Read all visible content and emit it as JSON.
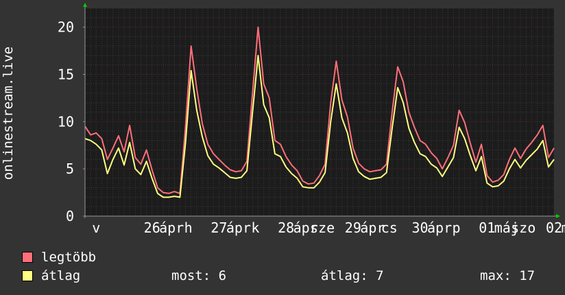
{
  "chart_data": {
    "type": "line",
    "ylabel": "onlinestream.live",
    "ylim": [
      0,
      22
    ],
    "yticks": [
      0,
      5,
      10,
      15,
      20
    ],
    "grid": true,
    "xlim": [
      0,
      168
    ],
    "xtick_labels": [
      {
        "x": 4,
        "label": "v"
      },
      {
        "x": 24,
        "label": "26"
      },
      {
        "x": 31,
        "label": "ápr"
      },
      {
        "x": 37,
        "label": "h"
      },
      {
        "x": 48,
        "label": "27"
      },
      {
        "x": 55,
        "label": "ápr"
      },
      {
        "x": 61,
        "label": "k"
      },
      {
        "x": 72,
        "label": "28"
      },
      {
        "x": 79,
        "label": "ápr"
      },
      {
        "x": 85,
        "label": "sze"
      },
      {
        "x": 96,
        "label": "29"
      },
      {
        "x": 103,
        "label": "ápr"
      },
      {
        "x": 109,
        "label": "cs"
      },
      {
        "x": 120,
        "label": "30"
      },
      {
        "x": 127,
        "label": "ápr"
      },
      {
        "x": 133,
        "label": "p"
      },
      {
        "x": 144,
        "label": "01"
      },
      {
        "x": 151,
        "label": "máj"
      },
      {
        "x": 157,
        "label": "szo"
      },
      {
        "x": 168,
        "label": "02"
      },
      {
        "x": 175,
        "label": "máj"
      }
    ],
    "series": [
      {
        "name": "legtöbb",
        "color": "#ff6f7a",
        "x": [
          0,
          2,
          4,
          6,
          8,
          10,
          12,
          14,
          16,
          18,
          20,
          22,
          24,
          26,
          28,
          30,
          32,
          34,
          36,
          38,
          40,
          42,
          44,
          46,
          48,
          50,
          52,
          54,
          56,
          58,
          60,
          62,
          64,
          66,
          68,
          70,
          72,
          74,
          76,
          78,
          80,
          82,
          84,
          86,
          88,
          90,
          92,
          94,
          96,
          98,
          100,
          102,
          104,
          106,
          108,
          110,
          112,
          114,
          116,
          118,
          120,
          122,
          124,
          126,
          128,
          130,
          132,
          134,
          136,
          138,
          140,
          142,
          144,
          146,
          148,
          150,
          152,
          154,
          156,
          158,
          160,
          162,
          164,
          166,
          168
        ],
        "values": [
          9.5,
          8.6,
          8.8,
          8.2,
          6.0,
          7.2,
          8.5,
          6.8,
          9.6,
          6.2,
          5.5,
          7.0,
          4.9,
          3.0,
          2.5,
          2.4,
          2.6,
          2.4,
          9.5,
          18.0,
          13.5,
          9.8,
          7.6,
          6.6,
          6.0,
          5.4,
          4.9,
          4.7,
          4.8,
          5.8,
          13.0,
          20.0,
          14.0,
          12.5,
          8.0,
          7.6,
          6.3,
          5.4,
          4.8,
          3.7,
          3.4,
          3.5,
          4.3,
          5.5,
          12.0,
          16.4,
          12.3,
          10.5,
          7.2,
          5.6,
          5.0,
          4.7,
          4.8,
          4.9,
          5.5,
          11.0,
          15.8,
          14.2,
          11.0,
          9.4,
          8.0,
          7.6,
          6.7,
          6.1,
          5.0,
          6.2,
          7.5,
          11.2,
          9.9,
          7.7,
          5.7,
          7.6,
          4.3,
          3.6,
          3.8,
          4.4,
          6.0,
          7.2,
          6.1,
          7.1,
          7.8,
          8.6,
          9.6,
          6.2,
          7.2
        ]
      },
      {
        "name": "átlag",
        "color": "#ffff80",
        "x": [
          0,
          2,
          4,
          6,
          8,
          10,
          12,
          14,
          16,
          18,
          20,
          22,
          24,
          26,
          28,
          30,
          32,
          34,
          36,
          38,
          40,
          42,
          44,
          46,
          48,
          50,
          52,
          54,
          56,
          58,
          60,
          62,
          64,
          66,
          68,
          70,
          72,
          74,
          76,
          78,
          80,
          82,
          84,
          86,
          88,
          90,
          92,
          94,
          96,
          98,
          100,
          102,
          104,
          106,
          108,
          110,
          112,
          114,
          116,
          118,
          120,
          122,
          124,
          126,
          128,
          130,
          132,
          134,
          136,
          138,
          140,
          142,
          144,
          146,
          148,
          150,
          152,
          154,
          156,
          158,
          160,
          162,
          164,
          166,
          168
        ],
        "values": [
          8.2,
          8.0,
          7.6,
          7.0,
          4.5,
          6.0,
          7.2,
          5.4,
          7.8,
          5.0,
          4.4,
          5.8,
          4.0,
          2.4,
          2.0,
          2.0,
          2.1,
          2.0,
          7.8,
          15.4,
          11.2,
          8.4,
          6.4,
          5.5,
          5.1,
          4.6,
          4.1,
          4.0,
          4.1,
          4.8,
          11.0,
          17.0,
          11.8,
          10.4,
          6.6,
          6.3,
          5.2,
          4.5,
          4.0,
          3.1,
          3.0,
          3.0,
          3.6,
          4.6,
          10.0,
          14.0,
          10.4,
          8.8,
          6.1,
          4.7,
          4.2,
          3.9,
          4.0,
          4.1,
          4.6,
          9.3,
          13.6,
          12.0,
          9.3,
          7.8,
          6.6,
          6.3,
          5.5,
          5.1,
          4.2,
          5.2,
          6.2,
          9.4,
          8.2,
          6.4,
          4.8,
          6.3,
          3.5,
          3.1,
          3.2,
          3.7,
          5.0,
          6.0,
          5.1,
          5.9,
          6.5,
          7.1,
          8.0,
          5.2,
          6.0
        ]
      }
    ]
  },
  "legend": {
    "items": [
      {
        "label": "legtöbb",
        "color": "#ff6f7a"
      },
      {
        "label": "átlag",
        "color": "#ffff80"
      }
    ],
    "now_text": "most: 6",
    "avg_text": "átlag: 7",
    "max_text": "max: 17"
  }
}
